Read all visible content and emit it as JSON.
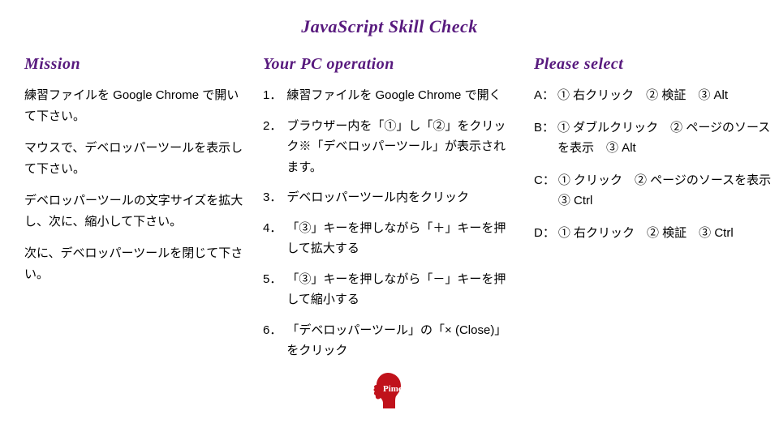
{
  "page_title": "JavaScript Skill Check",
  "mission": {
    "heading": "Mission",
    "paras": [
      "練習ファイルを Google Chrome で開いて下さい。",
      "マウスで、デベロッパーツールを表示して下さい。",
      "デベロッパーツールの文字サイズを拡大し、次に、縮小して下さい。",
      "次に、デベロッパーツールを閉じて下さい。"
    ]
  },
  "operations": {
    "heading": "Your PC operation",
    "items": [
      "練習ファイルを Google Chrome で開く",
      "ブラウザー内を「①」し「②」をクリック※「デベロッパーツール」が表示されます。",
      "デベロッパーツール内をクリック",
      "「③」キーを押しながら「＋」キーを押して拡大する",
      "「③」キーを押しながら「－」キーを押して縮小する",
      "「デベロッパーツール」の「× (Close)」をクリック"
    ]
  },
  "select": {
    "heading": "Please select",
    "options": [
      {
        "label": "A：",
        "body": "① 右クリック　② 検証　③ Alt"
      },
      {
        "label": "B：",
        "body": "① ダブルクリック　② ページのソースを表示　③ Alt"
      },
      {
        "label": "C：",
        "body": "① クリック　② ページのソースを表示　③ Ctrl"
      },
      {
        "label": "D：",
        "body": "① 右クリック　② 検証　③ Ctrl"
      }
    ]
  },
  "logo_text": "Pimc"
}
